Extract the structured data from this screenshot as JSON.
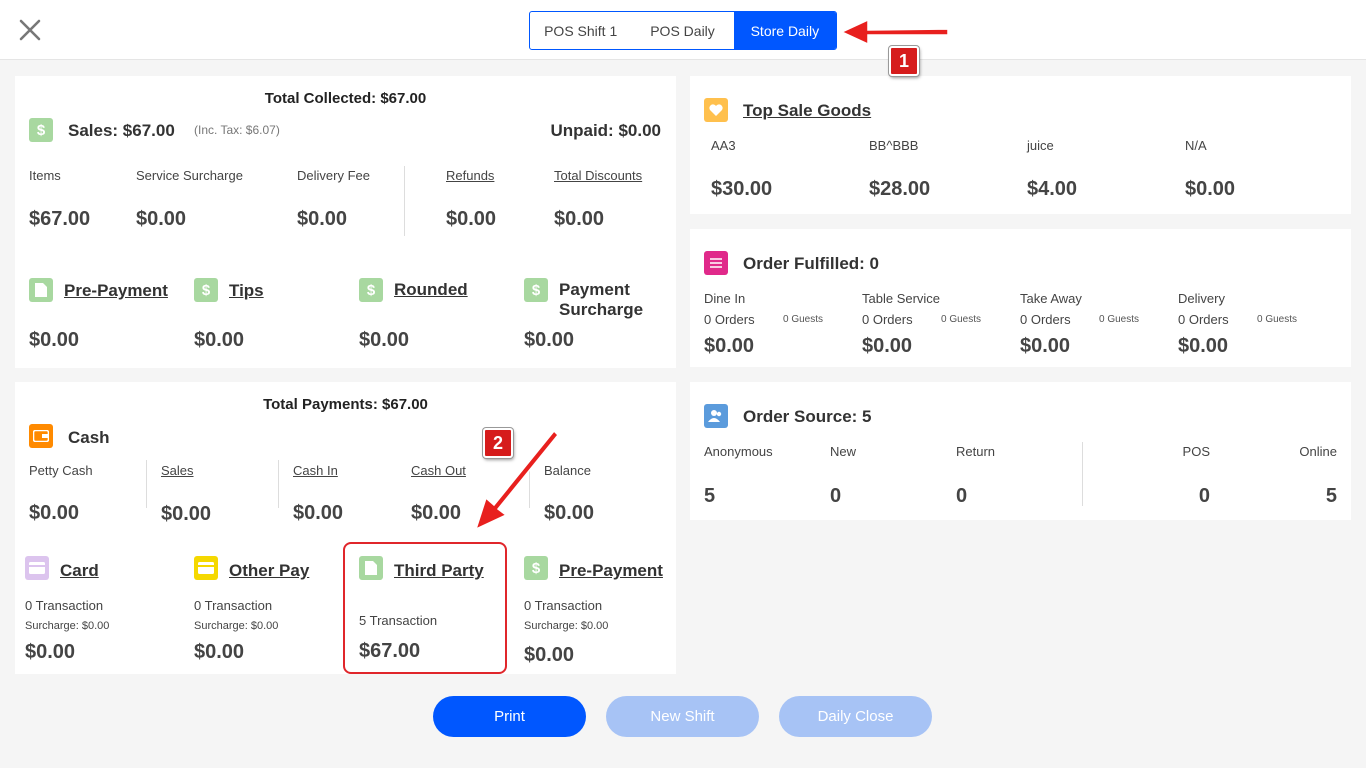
{
  "tabs": [
    "POS Shift 1",
    "POS Daily",
    "Store Daily"
  ],
  "collected": {
    "total": "Total Collected: $67.00",
    "sales": "Sales: $67.00",
    "inc_tax": "(Inc. Tax: $6.07)",
    "unpaid": "Unpaid: $0.00",
    "cols": [
      {
        "label": "Items",
        "value": "$67.00"
      },
      {
        "label": "Service Surcharge",
        "value": "$0.00"
      },
      {
        "label": "Delivery Fee",
        "value": "$0.00"
      },
      {
        "label": "Refunds",
        "value": "$0.00"
      },
      {
        "label": "Total Discounts",
        "value": "$0.00"
      }
    ],
    "extras": [
      {
        "label": "Pre-Payment",
        "value": "$0.00"
      },
      {
        "label": "Tips",
        "value": "$0.00"
      },
      {
        "label": "Rounded",
        "value": "$0.00"
      },
      {
        "label": "Payment Surcharge",
        "value": "$0.00"
      }
    ]
  },
  "payments": {
    "total": "Total Payments: $67.00",
    "cash_title": "Cash",
    "cash_cols": [
      {
        "label": "Petty Cash",
        "value": "$0.00"
      },
      {
        "label": "Sales",
        "value": "$0.00"
      },
      {
        "label": "Cash In",
        "value": "$0.00"
      },
      {
        "label": "Cash Out",
        "value": "$0.00"
      },
      {
        "label": "Balance",
        "value": "$0.00"
      }
    ],
    "methods": [
      {
        "label": "Card",
        "tx": "0 Transaction",
        "surcharge": "Surcharge: $0.00",
        "value": "$0.00"
      },
      {
        "label": "Other Pay",
        "tx": "0 Transaction",
        "surcharge": "Surcharge: $0.00",
        "value": "$0.00"
      },
      {
        "label": "Third Party",
        "tx": "5 Transaction",
        "value": "$67.00"
      },
      {
        "label": "Pre-Payment",
        "tx": "0 Transaction",
        "surcharge": "Surcharge: $0.00",
        "value": "$0.00"
      }
    ]
  },
  "top_sale": {
    "title": "Top Sale Goods",
    "items": [
      {
        "name": "AA3",
        "value": "$30.00"
      },
      {
        "name": "BB^BBB",
        "value": "$28.00"
      },
      {
        "name": "juice",
        "value": "$4.00"
      },
      {
        "name": "N/A",
        "value": "$0.00"
      }
    ]
  },
  "fulfilled": {
    "title": "Order Fulfilled: 0",
    "cols": [
      {
        "label": "Dine In",
        "orders": "0 Orders",
        "guests": "0 Guests",
        "value": "$0.00"
      },
      {
        "label": "Table Service",
        "orders": "0 Orders",
        "guests": "0 Guests",
        "value": "$0.00"
      },
      {
        "label": "Take Away",
        "orders": "0 Orders",
        "guests": "0 Guests",
        "value": "$0.00"
      },
      {
        "label": "Delivery",
        "orders": "0 Orders",
        "guests": "0 Guests",
        "value": "$0.00"
      }
    ]
  },
  "source": {
    "title": "Order Source: 5",
    "cols": [
      {
        "label": "Anonymous",
        "value": "5"
      },
      {
        "label": "New",
        "value": "0"
      },
      {
        "label": "Return",
        "value": "0"
      },
      {
        "label": "POS",
        "value": "0"
      },
      {
        "label": "Online",
        "value": "5"
      }
    ]
  },
  "buttons": {
    "print": "Print",
    "new_shift": "New Shift",
    "daily_close": "Daily Close"
  },
  "annotations": {
    "badge1": "1",
    "badge2": "2"
  },
  "icons": {
    "dollar": "$"
  },
  "colors": {
    "accent": "#0057ff",
    "disabled": "#a7c3f5",
    "highlight": "#e0262b"
  }
}
